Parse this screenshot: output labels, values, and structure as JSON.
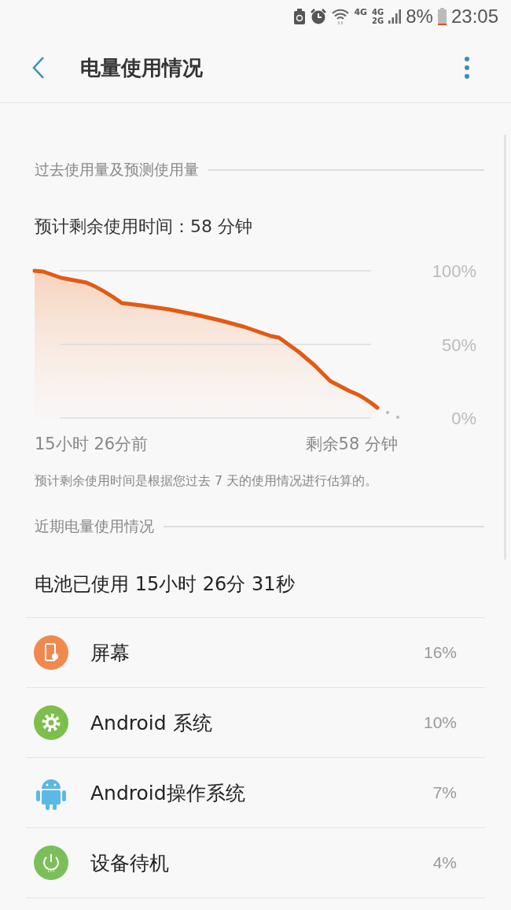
{
  "status_bar": {
    "network_1": "4G",
    "network_2_top": "4G",
    "network_2_bottom": "2G",
    "battery": "8%",
    "time": "23:05"
  },
  "header": {
    "title": "电量使用情况"
  },
  "history_section": {
    "title": "过去使用量及预测使用量",
    "estimate": "预计剩余使用时间：58 分钟",
    "graph": {
      "y_labels": [
        "100%",
        "50%",
        "0%"
      ],
      "x_labels": [
        "15小时 26分前",
        "剩余58 分钟"
      ]
    },
    "note": "预计剩余使用时间是根据您过去 7 天的使用情况进行估算的。"
  },
  "recent_section": {
    "title": "近期电量使用情况",
    "total": "电池已使用 15小时 26分 31秒",
    "items": [
      {
        "kind": "screen",
        "name": "屏幕",
        "percent": "16%",
        "color": "#ef8a4f"
      },
      {
        "kind": "system",
        "name": "Android 系统",
        "percent": "10%",
        "color": "#7cbf4a"
      },
      {
        "kind": "android",
        "name": "Android操作系统",
        "percent": "7%",
        "color": "#5cb8e6"
      },
      {
        "kind": "standby",
        "name": "设备待机",
        "percent": "4%",
        "color": "#7cbf5a"
      }
    ]
  }
}
